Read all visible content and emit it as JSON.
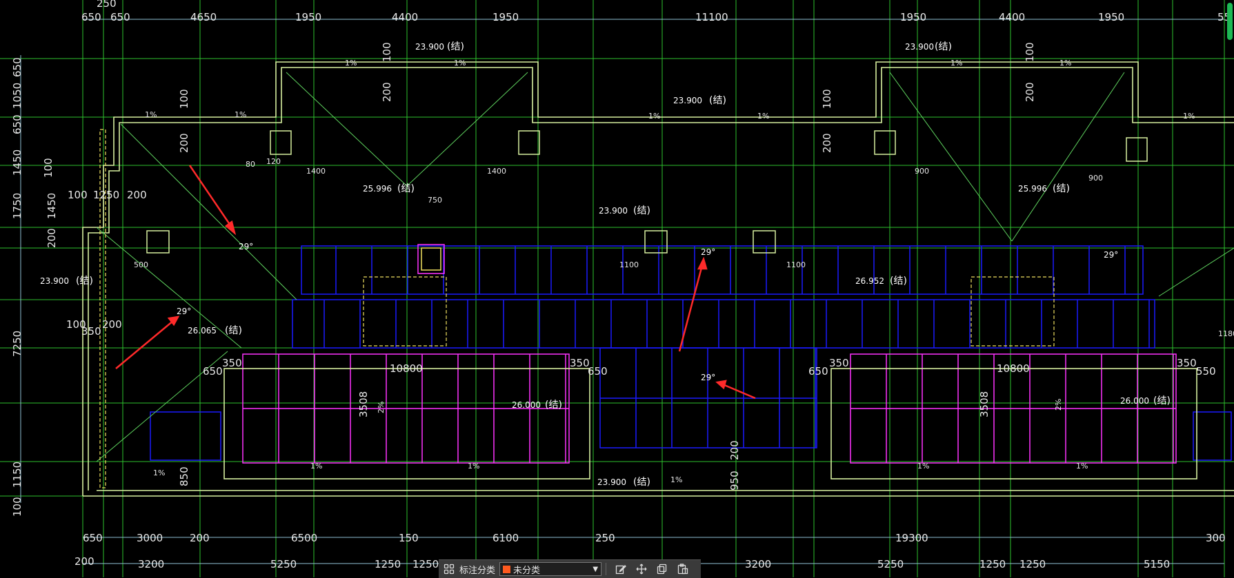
{
  "colors": {
    "background": "#000000",
    "wall": "#d8f0a0",
    "axis": "#2ec22e",
    "dim": "#8fbfd4",
    "blue_panel": "#1a1aff",
    "magenta_panel": "#ff33ff",
    "arrow": "#ff2a2a",
    "scrollbar": "#1db954"
  },
  "top_dims": [
    "650",
    "650",
    "4650",
    "1950",
    "4400",
    "1950",
    "11100",
    "1950",
    "4400",
    "1950",
    "55"
  ],
  "left_dims": [
    "650",
    "1050",
    "650",
    "1450",
    "1750",
    "1450",
    "200",
    "100",
    "7250",
    "1150",
    "100"
  ],
  "bottom_dims_row1": [
    "650",
    "3000",
    "200",
    "6500",
    "150",
    "6100",
    "250",
    "19300",
    "300"
  ],
  "bottom_dims_row2": [
    "200",
    "3200",
    "5250",
    "1250",
    "1250",
    "3200",
    "5250",
    "1250",
    "1250",
    "5150"
  ],
  "top_edge_label": "250",
  "levels": {
    "l1": "23.900",
    "l2": "23.900",
    "l3": "23.900",
    "l4": "25.996",
    "l5": "23.900",
    "l6": "25.996",
    "l7": "23.900",
    "l8": "26.065",
    "l9": "26.952",
    "l10": "26.000",
    "l11": "26.000",
    "l12": "23.900",
    "l13": "(结)"
  },
  "slopes": [
    "1%",
    "29°",
    "2%"
  ],
  "interior_dims": {
    "d10800a": "10800",
    "d10800b": "10800",
    "d3508a": "3508",
    "d3508b": "3508",
    "d1250": "1250",
    "d200": "200",
    "d100": "100",
    "d650": "650",
    "d350": "350",
    "d550": "550",
    "d1100": "1100",
    "d1400": "1400",
    "d900": "900",
    "d750": "750",
    "d500": "500",
    "d950": "950",
    "d850": "850",
    "d1180": "1180",
    "d80": "80",
    "d120": "120"
  },
  "toolbar": {
    "label": "标注分类",
    "selected": "未分类"
  },
  "icons": [
    "grid-icon",
    "edit-icon",
    "move-icon",
    "copy-icon",
    "paste-icon"
  ]
}
